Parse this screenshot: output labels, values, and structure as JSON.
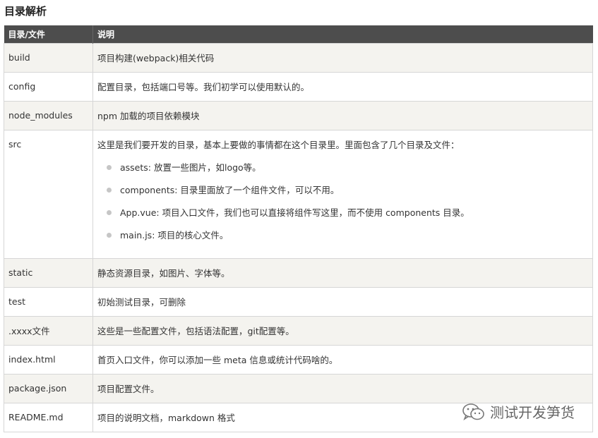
{
  "page": {
    "title": "目录解析"
  },
  "table": {
    "headers": [
      "目录/文件",
      "说明"
    ],
    "rows": [
      {
        "name": "build",
        "desc": "项目构建(webpack)相关代码"
      },
      {
        "name": "config",
        "desc": "配置目录，包括端口号等。我们初学可以使用默认的。"
      },
      {
        "name": "node_modules",
        "desc": "npm 加载的项目依赖模块"
      },
      {
        "name": "src",
        "desc": "这里是我们要开发的目录，基本上要做的事情都在这个目录里。里面包含了几个目录及文件：",
        "items": [
          "assets: 放置一些图片，如logo等。",
          "components: 目录里面放了一个组件文件，可以不用。",
          "App.vue: 项目入口文件，我们也可以直接将组件写这里，而不使用 components 目录。",
          "main.js: 项目的核心文件。"
        ]
      },
      {
        "name": "static",
        "desc": "静态资源目录，如图片、字体等。"
      },
      {
        "name": "test",
        "desc": "初始测试目录，可删除"
      },
      {
        "name": ".xxxx文件",
        "desc": "这些是一些配置文件，包括语法配置，git配置等。"
      },
      {
        "name": "index.html",
        "desc": "首页入口文件，你可以添加一些 meta 信息或统计代码啥的。"
      },
      {
        "name": "package.json",
        "desc": "项目配置文件。"
      },
      {
        "name": "README.md",
        "desc": "项目的说明文档，markdown 格式"
      }
    ]
  },
  "watermark": {
    "text": "测试开发笋货",
    "icon": "wechat-icon"
  }
}
